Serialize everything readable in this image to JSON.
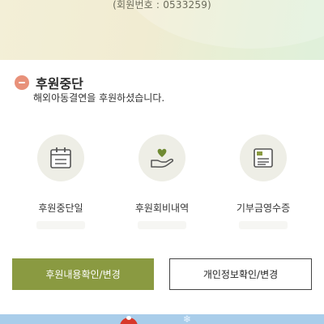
{
  "header": {
    "member_no": "(회원번호 : 0533259)"
  },
  "status": {
    "title": "후원중단",
    "description": "해외아동결연을 후원하셨습니다."
  },
  "menu": [
    {
      "label": "후원중단일",
      "icon": "calendar-icon"
    },
    {
      "label": "후원회비내역",
      "icon": "hand-heart-icon"
    },
    {
      "label": "기부금영수증",
      "icon": "receipt-document-icon"
    }
  ],
  "buttons": {
    "primary": "후원내용확인/변경",
    "secondary": "개인정보확인/변경"
  },
  "colors": {
    "accent": "#8a9a41",
    "status_badge": "#e8917a",
    "icon_bg": "#eeeee6",
    "bottom_banner": "#a9cdea"
  }
}
